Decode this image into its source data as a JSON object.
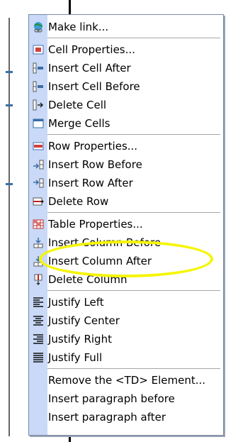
{
  "menu": {
    "items": [
      {
        "label": "Make link...",
        "icon": "globe-link-icon"
      },
      {
        "label": "Cell Properties...",
        "icon": "cell-properties-icon"
      },
      {
        "label": "Insert Cell After",
        "icon": "insert-cell-after-icon"
      },
      {
        "label": "Insert Cell Before",
        "icon": "insert-cell-before-icon"
      },
      {
        "label": "Delete Cell",
        "icon": "delete-cell-icon"
      },
      {
        "label": "Merge Cells",
        "icon": "merge-cells-icon"
      },
      {
        "label": "Row Properties...",
        "icon": "row-properties-icon"
      },
      {
        "label": "Insert Row Before",
        "icon": "insert-row-before-icon"
      },
      {
        "label": "Insert Row After",
        "icon": "insert-row-after-icon"
      },
      {
        "label": "Delete Row",
        "icon": "delete-row-icon"
      },
      {
        "label": "Table Properties...",
        "icon": "table-properties-icon"
      },
      {
        "label": "Insert Column Before",
        "icon": "insert-column-before-icon"
      },
      {
        "label": "Insert Column After",
        "icon": "insert-column-after-icon"
      },
      {
        "label": "Delete Column",
        "icon": "delete-column-icon"
      },
      {
        "label": "Justify Left",
        "icon": "justify-left-icon"
      },
      {
        "label": "Justify Center",
        "icon": "justify-center-icon"
      },
      {
        "label": "Justify Right",
        "icon": "justify-right-icon"
      },
      {
        "label": "Justify Full",
        "icon": "justify-full-icon"
      },
      {
        "label": "Remove the <TD> Element...",
        "icon": ""
      },
      {
        "label": "Insert paragraph before",
        "icon": ""
      },
      {
        "label": "Insert paragraph after",
        "icon": ""
      }
    ],
    "highlighted_item": "Table Properties...",
    "colors": {
      "icon_strip": "#c9d9f7",
      "highlight_ellipse": "#f5f500",
      "separator": "#a7a7a7"
    }
  }
}
